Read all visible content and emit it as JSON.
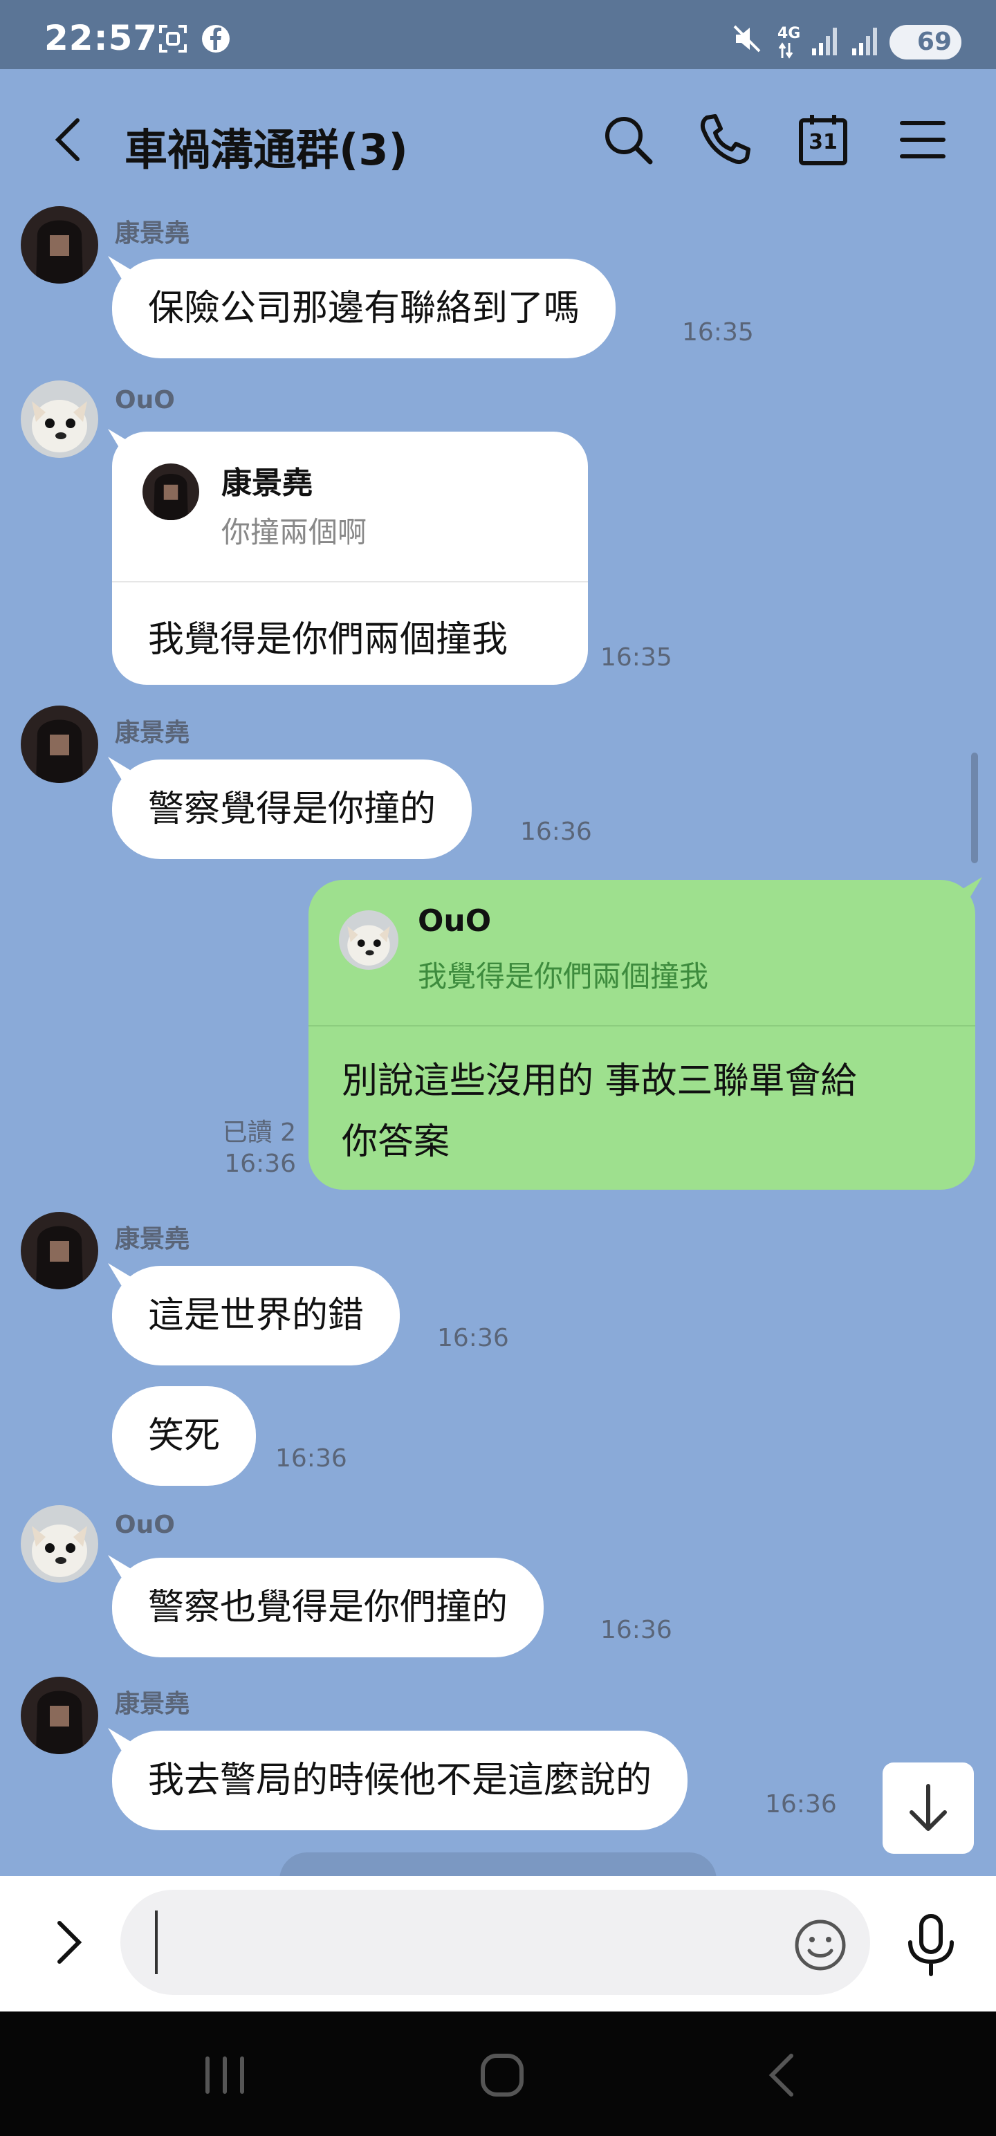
{
  "status_bar": {
    "time": "22:57",
    "battery": "69",
    "network": "4G",
    "icons": [
      "screenshot-icon",
      "facebook-icon",
      "mute-icon",
      "signal-icon",
      "signal-icon",
      "battery-icon"
    ]
  },
  "header": {
    "title": "車禍溝通群(3)",
    "icons": [
      "back-icon",
      "search-icon",
      "phone-icon",
      "calendar-icon",
      "menu-icon"
    ],
    "calendar_day": "31"
  },
  "messages": [
    {
      "sender": "康景堯",
      "text": "保險公司那邊有聯絡到了嗎",
      "time": "16:35"
    },
    {
      "sender": "OuO",
      "reply_to_name": "康景堯",
      "reply_to_text": "你撞兩個啊",
      "text": "我覺得是你們兩個撞我",
      "time": "16:35"
    },
    {
      "sender": "康景堯",
      "text": "警察覺得是你撞的",
      "time": "16:36"
    },
    {
      "mine": true,
      "reply_to_name": "OuO",
      "reply_to_text": "我覺得是你們兩個撞我",
      "text_line1": "別說這些沒用的 事故三聯單會給",
      "text_line2": "你答案",
      "read": "已讀 2",
      "time": "16:36"
    },
    {
      "sender": "康景堯",
      "text": "這是世界的錯",
      "time": "16:36"
    },
    {
      "sender": "康景堯",
      "text": "笑死",
      "time": "16:36"
    },
    {
      "sender": "OuO",
      "text": "警察也覺得是你們撞的",
      "time": "16:36"
    },
    {
      "sender": "康景堯",
      "text": "我去警局的時候他不是這麼說的",
      "time": "16:36"
    }
  ],
  "input": {
    "placeholder": "",
    "icons": [
      "expand-icon",
      "emoji-icon",
      "mic-icon"
    ]
  },
  "colors": {
    "background": "#8aaad8",
    "status_bar": "#5b7596",
    "my_bubble": "#9ee08e",
    "other_bubble": "#ffffff"
  }
}
